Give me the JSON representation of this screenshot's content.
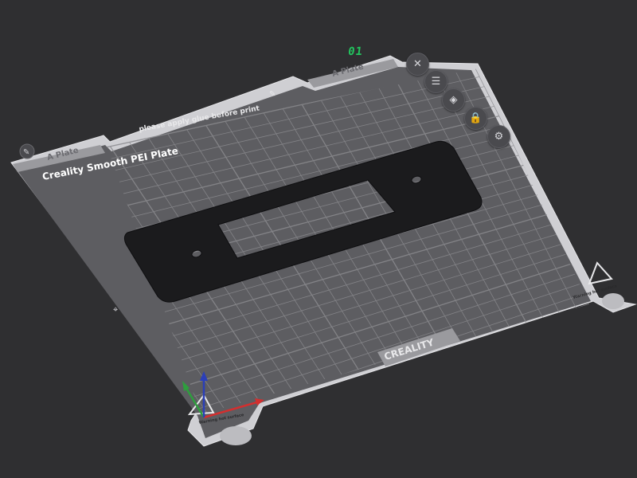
{
  "plate": {
    "index": "01",
    "name": "Creality Smooth PEI Plate",
    "tab_label": "A Plate",
    "glue_notice": "please apply glue before print",
    "brand": "CREALITY",
    "warning_text": "Warning hot surface"
  },
  "toolbar": [
    {
      "name": "close",
      "icon": "close-icon",
      "glyph": "✕"
    },
    {
      "name": "arrange",
      "icon": "arrange-icon",
      "glyph": "☰"
    },
    {
      "name": "auto-orient",
      "icon": "auto-orient-icon",
      "glyph": "◈"
    },
    {
      "name": "lock",
      "icon": "lock-icon",
      "glyph": "🔒"
    },
    {
      "name": "settings",
      "icon": "gear-icon",
      "glyph": "⚙"
    }
  ],
  "colors": {
    "background": "#2f2f31",
    "bed": "#5d5d61",
    "grid": "#8a8a8e",
    "part": "#1b1b1d",
    "plate_index": "#22c55e",
    "axis_x": "#d32f2f",
    "axis_y": "#2e9e3e",
    "axis_z": "#2b3fb8"
  }
}
